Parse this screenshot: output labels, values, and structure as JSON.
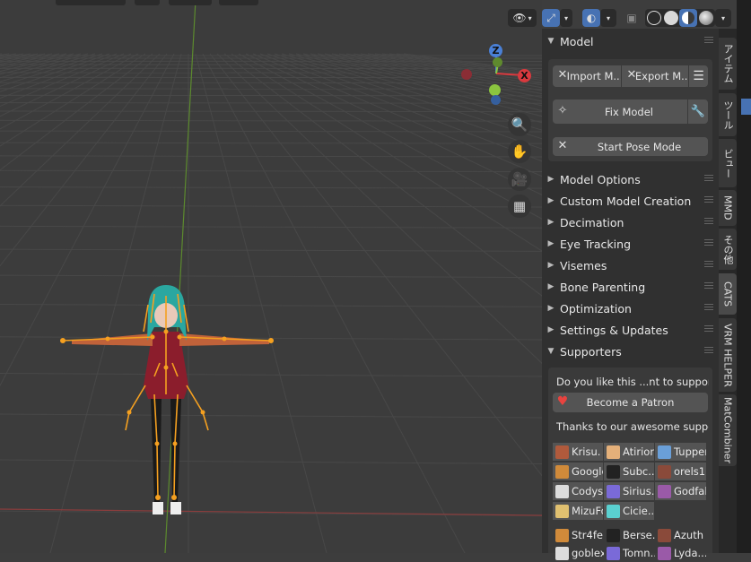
{
  "viewport": {
    "header_icons": [
      "visibility-icon",
      "gizmo-toggle-icon",
      "overlay-icon",
      "xray-icon",
      "wireframe-shading-icon",
      "solid-shading-icon",
      "material-shading-icon",
      "rendered-shading-icon"
    ],
    "gizmo": {
      "z_label": "Z",
      "x_label": "X"
    },
    "nav_icons": [
      "zoom-icon",
      "hand-pan-icon",
      "camera-icon",
      "grid-perspective-icon"
    ]
  },
  "sidebar": {
    "model_panel": {
      "title": "Model",
      "import_label": "Import M...",
      "export_label": "Export M...",
      "fix_model_label": "Fix Model",
      "start_pose_label": "Start Pose Mode"
    },
    "collapsed_panels": [
      "Model Options",
      "Custom Model Creation",
      "Decimation",
      "Eye Tracking",
      "Visemes",
      "Bone Parenting",
      "Optimization",
      "Settings & Updates"
    ],
    "supporters_panel": {
      "title": "Supporters",
      "prompt": "Do you like this ...nt to support us",
      "patron_button": "Become a Patron",
      "thanks": "Thanks to our awesome support...",
      "grid": [
        [
          "Krisu.",
          "Atirion",
          "Tupper"
        ],
        [
          "Google",
          "Subc...",
          "orels1"
        ],
        [
          "Codys",
          "Sirius...",
          "Godfall"
        ],
        [
          "MizuFo",
          "Cicie..."
        ]
      ],
      "plain": [
        [
          "Str4fe",
          "Berse...",
          "Azuth"
        ],
        [
          "goblex",
          "Tomn...",
          "Lyda..."
        ]
      ]
    }
  },
  "tabs": [
    "アイテム",
    "ツール",
    "ビュー",
    "MMD",
    "その他",
    "CATS",
    "VRM HELPER",
    "MatCombiner"
  ],
  "colors": {
    "accent": "#4772b3",
    "bone": "#f5a020",
    "x_axis": "#d9393e",
    "y_axis": "#8bc53f",
    "z_axis": "#4a80d6"
  }
}
